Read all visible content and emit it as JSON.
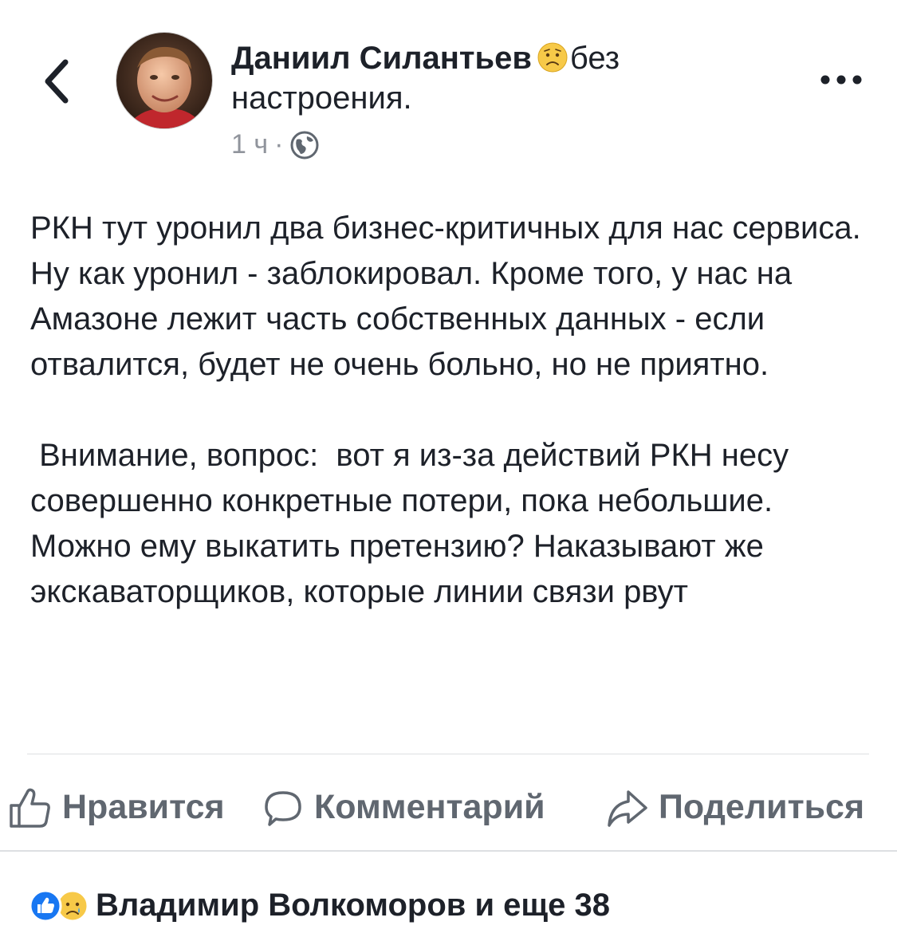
{
  "header": {
    "author_name": "Даниил Силантьев",
    "feeling_emoji": "sad-face-icon",
    "feeling_text_1": "без",
    "feeling_text_2": "настроения.",
    "time": "1 ч",
    "separator": "·",
    "privacy_icon": "globe-icon"
  },
  "post": {
    "paragraph_1": "РКН тут уронил два бизнес-критичных для нас сервиса. Ну как уронил - заблокировал. Кроме того, у нас на Амазоне лежит часть собственных данных - если отвалится, будет не очень больно, но не приятно.",
    "paragraph_2": " Внимание, вопрос:  вот я из-за действий РКН несу совершенно конкретные потери, пока небольшие. Можно ему выкатить претензию? Наказывают же экскаваторщиков, которые линии связи рвут"
  },
  "actions": {
    "like_label": "Нравится",
    "comment_label": "Комментарий",
    "share_label": "Поделиться"
  },
  "reactions": {
    "summary": "Владимир Волкоморов и еще 38",
    "icons": [
      "like-icon",
      "sad-face-icon"
    ]
  },
  "colors": {
    "text": "#1d2129",
    "secondary": "#90949c",
    "action": "#606770",
    "like_blue": "#1877f2",
    "emoji_yellow": "#f7c948",
    "divider": "#dddfe2"
  }
}
